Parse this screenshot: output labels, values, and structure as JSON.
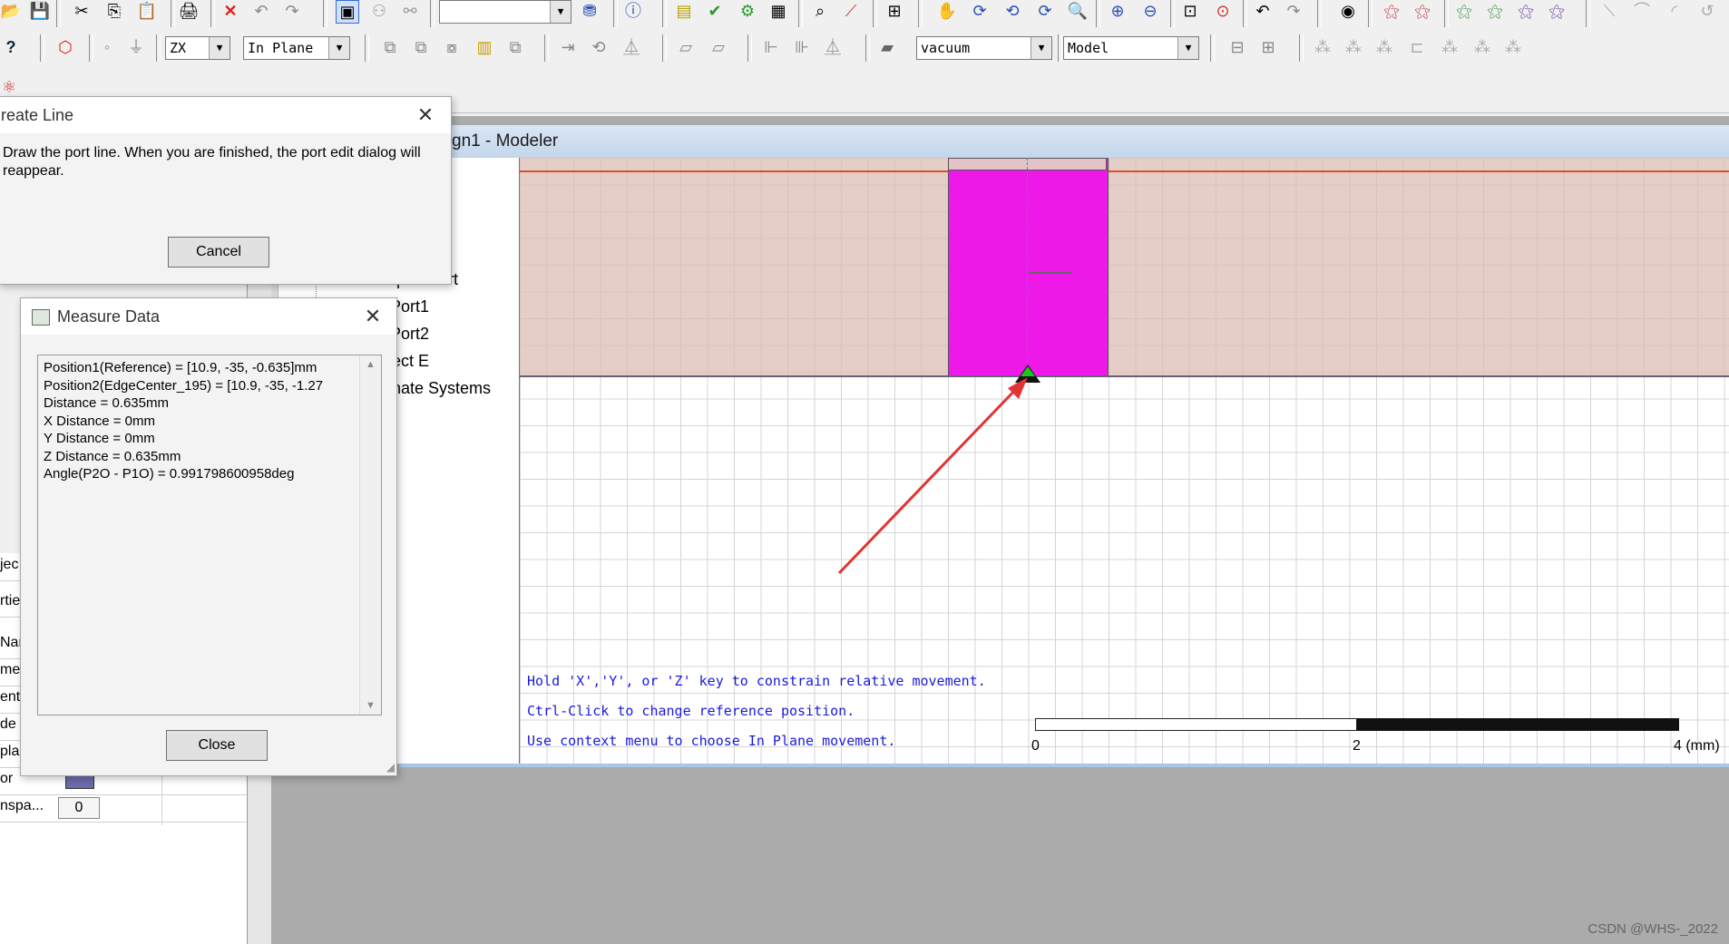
{
  "toolbar1": {
    "icons": [
      "open-icon",
      "save-icon",
      "cut-icon",
      "copy-icon",
      "paste-icon",
      "print-icon",
      "delete-icon",
      "undo-icon",
      "redo-icon",
      "select-icon",
      "model-icon",
      "split-icon",
      "blank-combo",
      "filter-icon",
      "info-icon",
      "validate-icon",
      "check-icon",
      "analyze-icon",
      "report-icon",
      "fit-icon",
      "plot-icon",
      "field-icon",
      "pan-icon",
      "rotate-icon",
      "rotate2-icon",
      "rotate3-icon",
      "zoom-icon",
      "zoom-in-icon",
      "zoom-out-icon",
      "zoom-area-icon",
      "zoom-all-icon",
      "undo-view-icon",
      "redo-view-icon",
      "view-icon",
      "show-icon",
      "hide-icon",
      "show2-icon",
      "hide2-icon",
      "show3-icon",
      "hide3-icon",
      "line-icon",
      "curve-icon",
      "arc-icon",
      "spline-icon"
    ]
  },
  "toolbar2": {
    "plane_value": "ZX",
    "movement_value": "In Plane",
    "material_value": "vacuum",
    "mode_value": "Model"
  },
  "modeler": {
    "title": "gn1 - Modeler"
  },
  "tree": {
    "items": [
      "Lumped Port",
      "Port1",
      "Port2",
      "ect E",
      "nate Systems"
    ]
  },
  "create_line_dialog": {
    "title": "reate Line",
    "message": "Draw the port line.  When you are finished, the port edit dialog will reappear.",
    "cancel_label": "Cancel"
  },
  "measure_dialog": {
    "title": "Measure Data",
    "lines": [
      "Position1(Reference) = [10.9, -35, -0.635]mm",
      "Position2(EdgeCenter_195) = [10.9, -35, -1.27",
      "Distance = 0.635mm",
      "X Distance = 0mm",
      "Y Distance = 0mm",
      "Z Distance = 0.635mm",
      "Angle(P2O - P1O) = 0.991798600958deg"
    ],
    "close_label": "Close"
  },
  "canvas": {
    "hints": [
      "Hold 'X','Y', or 'Z' key to constrain relative movement.",
      "Ctrl-Click to change reference position.",
      "Use context menu to choose In Plane movement."
    ],
    "scale_labels": [
      "0",
      "2",
      "4 (mm)"
    ],
    "substrate_color": "#dcbeb4",
    "trace_color": "#ee18e8",
    "marker_color": "#18c818",
    "arrow_color": "#e33333"
  },
  "properties": {
    "left_labels": [
      "jec",
      "rtie",
      "Nan",
      "me",
      "ent",
      "de",
      "pla",
      "or",
      "nspa..."
    ],
    "color_swatch": "#6b6bab",
    "transparency_value": "0"
  },
  "watermark": "CSDN @WHS-_2022"
}
